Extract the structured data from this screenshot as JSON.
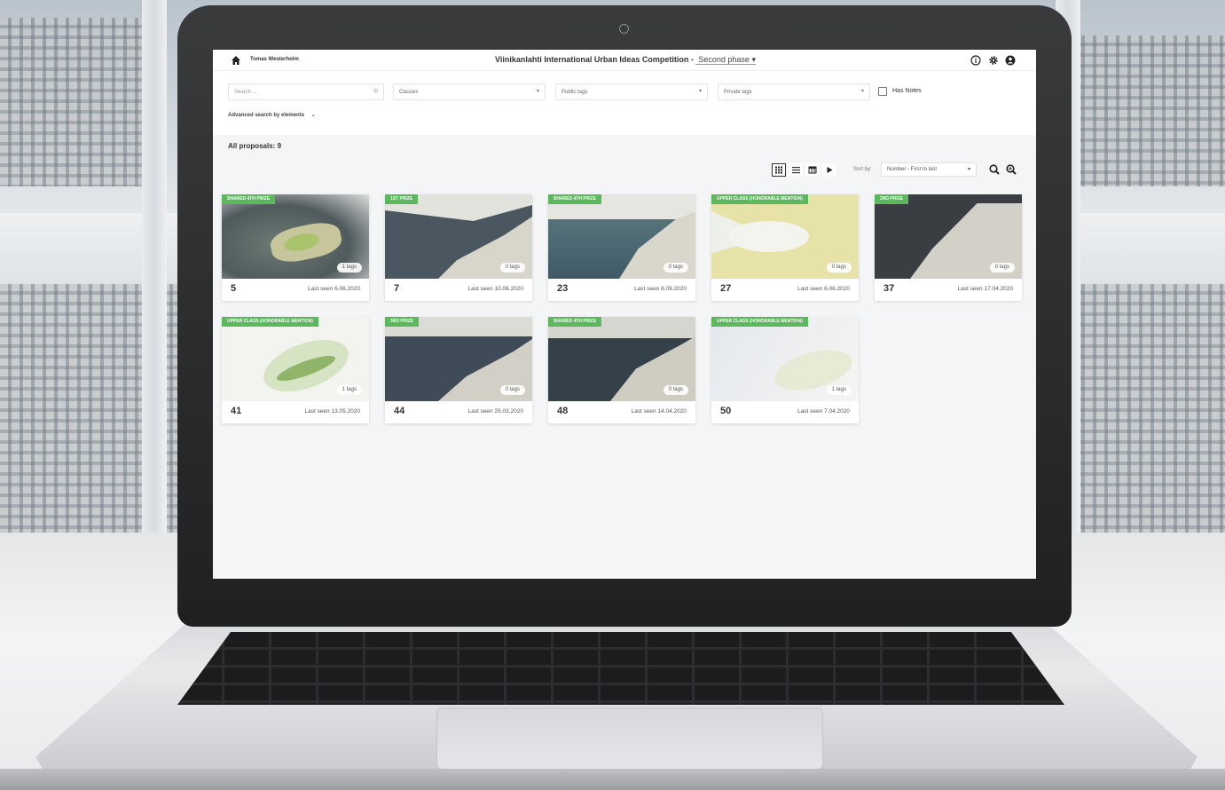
{
  "header": {
    "user_name": "Tomas Westerholm",
    "competition_title": "Viinikanlahti International Urban Ideas Competition -",
    "phase_label": "Second phase",
    "icons": [
      "home-icon",
      "info-icon",
      "gear-icon",
      "user-icon"
    ]
  },
  "filters": {
    "search_placeholder": "Search ...",
    "classes_label": "Classes",
    "public_tags_label": "Public tags",
    "private_tags_label": "Private tags",
    "has_notes_label": "Has Notes",
    "advanced_search_label": "Advanced search by elements"
  },
  "results": {
    "count_label": "All proposals: 9",
    "sort_label": "Sort by:",
    "sort_value": "Number - First to last",
    "view_modes": [
      "grid",
      "list",
      "table",
      "slideshow"
    ],
    "active_view": "grid"
  },
  "proposals": [
    {
      "number": "5",
      "prize": "SHARED 4TH PRIZE",
      "tags": "1 tags",
      "last_seen": "Last seen 6.06.2020"
    },
    {
      "number": "7",
      "prize": "1ST PRIZE",
      "tags": "0 tags",
      "last_seen": "Last seen 10.06.2020"
    },
    {
      "number": "23",
      "prize": "SHARED 4TH PRIZE",
      "tags": "0 tags",
      "last_seen": "Last seen 8.09.2020"
    },
    {
      "number": "27",
      "prize": "UPPER CLASS (HONORABLE MENTION)",
      "tags": "0 tags",
      "last_seen": "Last seen 6.06.2020"
    },
    {
      "number": "37",
      "prize": "2ND PRIZE",
      "tags": "0 tags",
      "last_seen": "Last seen 17.04.2020"
    },
    {
      "number": "41",
      "prize": "UPPER CLASS (HONORABLE MENTION)",
      "tags": "1 tags",
      "last_seen": "Last seen 13.05.2020"
    },
    {
      "number": "44",
      "prize": "3RD PRIZE",
      "tags": "0 tags",
      "last_seen": "Last seen 25.03.2020"
    },
    {
      "number": "48",
      "prize": "SHARED 4TH PRIZE",
      "tags": "0 tags",
      "last_seen": "Last seen 14.04.2020"
    },
    {
      "number": "50",
      "prize": "UPPER CLASS (HONORABLE MENTION)",
      "tags": "1 tags",
      "last_seen": "Last seen 7.04.2020"
    }
  ],
  "colors": {
    "prize_badge": "#5cb85c",
    "water_dark": "#3d4a55",
    "water_light": "#dfe4e6",
    "land": "#d9d6c8",
    "greenery": "#a9c46a"
  }
}
